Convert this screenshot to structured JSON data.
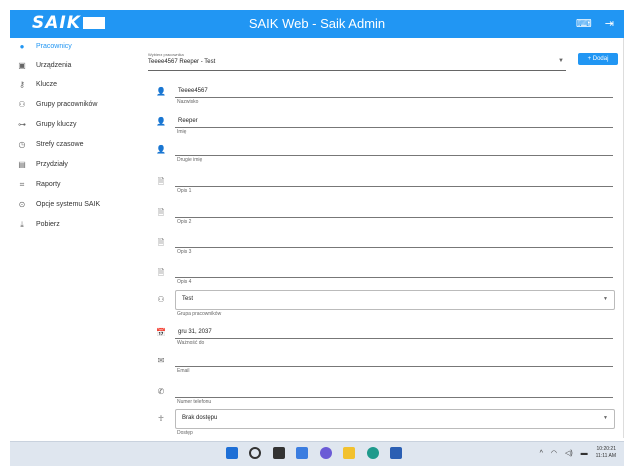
{
  "app": {
    "logo_text": "SAIK",
    "title": "SAIK Web - Saik Admin",
    "icons": [
      "keyboard-icon",
      "logout-icon"
    ]
  },
  "sidebar": {
    "items": [
      {
        "label": "Pracownicy",
        "icon": "person-circle-icon",
        "active": true
      },
      {
        "label": "Urządzenia",
        "icon": "device-icon"
      },
      {
        "label": "Klucze",
        "icon": "key-icon"
      },
      {
        "label": "Grupy pracowników",
        "icon": "group-icon"
      },
      {
        "label": "Grupy kluczy",
        "icon": "key-group-icon"
      },
      {
        "label": "Strefy czasowe",
        "icon": "clock-icon"
      },
      {
        "label": "Przydziały",
        "icon": "assignment-icon"
      },
      {
        "label": "Raporty",
        "icon": "report-icon"
      },
      {
        "label": "Opcje systemu SAIK",
        "icon": "settings-icon"
      },
      {
        "label": "Pobierz",
        "icon": "download-icon"
      }
    ]
  },
  "selector": {
    "label": "Wybierz pracownika",
    "value": "Teeee4567 Reeper - Test",
    "add_label": "Dodaj"
  },
  "fields": [
    {
      "icon": "person-icon",
      "value": "Teeee4567",
      "caption": "Nazwisko"
    },
    {
      "icon": "person-icon",
      "value": "Reeper",
      "caption": "Imię"
    },
    {
      "icon": "person-icon",
      "value": "",
      "caption": "Drugie imię"
    },
    {
      "icon": "document-icon",
      "value": "",
      "caption": "Opis 1"
    },
    {
      "icon": "document-icon",
      "value": "",
      "caption": "Opis 2"
    },
    {
      "icon": "document-icon",
      "value": "",
      "caption": "Opis 3"
    },
    {
      "icon": "document-icon",
      "value": "",
      "caption": "Opis 4"
    },
    {
      "icon": "group-icon",
      "value": "Test",
      "caption": "Grupa pracowników",
      "dropdown": true
    },
    {
      "icon": "calendar-icon",
      "value": "gru 31, 2037",
      "caption": "Ważność do"
    },
    {
      "icon": "email-icon",
      "value": "",
      "caption": "Email"
    },
    {
      "icon": "phone-icon",
      "value": "",
      "caption": "Numer telefonu"
    },
    {
      "icon": "accessibility-icon",
      "value": "Brak dostępu",
      "caption": "Dostęp",
      "dropdown": true
    }
  ],
  "taskbar": {
    "time": "10:20:21",
    "ampm": "11:11 AM"
  },
  "colors": {
    "accent": "#2196f3"
  }
}
